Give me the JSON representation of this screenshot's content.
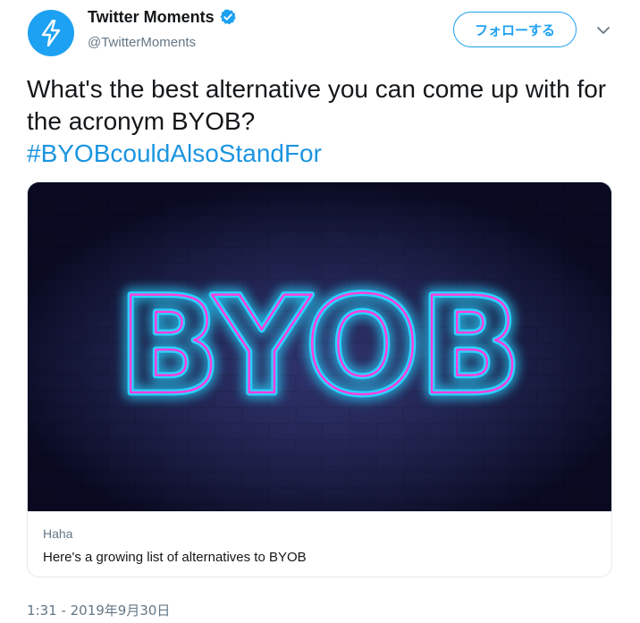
{
  "user": {
    "display_name": "Twitter Moments",
    "handle": "@TwitterMoments",
    "verified": true,
    "avatar_icon": "lightning-bolt-icon"
  },
  "follow_button": {
    "label": "フォローする"
  },
  "tweet": {
    "text": "What's the best alternative you can come up with for the acronym BYOB?",
    "hashtag": "#BYOBcouldAlsoStandFor"
  },
  "card": {
    "image_text": "BYOB",
    "domain": "Haha",
    "title": "Here's a growing list of alternatives to BYOB"
  },
  "timestamp": "1:31 - 2019年9月30日",
  "colors": {
    "brand_blue": "#1da1f2",
    "link_blue": "#1b95e0",
    "neon_cyan": "#27d3ff",
    "neon_pink": "#ff3fd8"
  }
}
